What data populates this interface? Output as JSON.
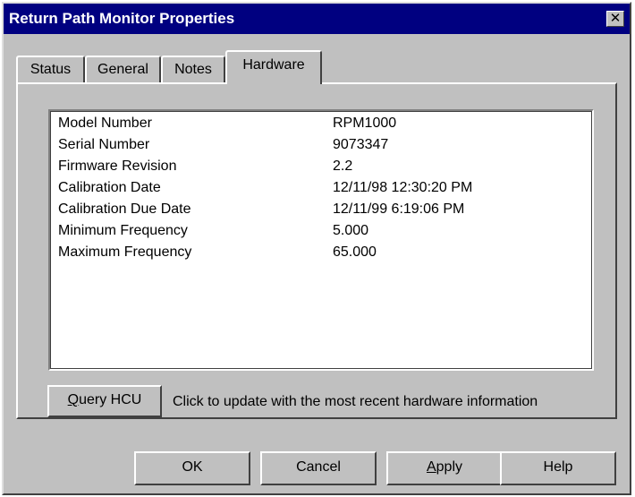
{
  "window": {
    "title": "Return Path Monitor Properties",
    "close_glyph": "✕"
  },
  "tabs": [
    {
      "label": "Status",
      "active": false
    },
    {
      "label": "General",
      "active": false
    },
    {
      "label": "Notes",
      "active": false
    },
    {
      "label": "Hardware",
      "active": true
    }
  ],
  "hardware": {
    "rows": [
      {
        "key": "Model Number",
        "value": "RPM1000"
      },
      {
        "key": "Serial Number",
        "value": "9073347"
      },
      {
        "key": "Firmware Revision",
        "value": "2.2"
      },
      {
        "key": "Calibration Date",
        "value": "12/11/98 12:30:20 PM"
      },
      {
        "key": "Calibration Due Date",
        "value": "12/11/99 6:19:06 PM"
      },
      {
        "key": "Minimum Frequency",
        "value": "5.000"
      },
      {
        "key": "Maximum Frequency",
        "value": "65.000"
      }
    ],
    "query_button_label": "Query HCU",
    "query_hint": "Click to update with the most recent hardware information"
  },
  "buttons": {
    "ok": "OK",
    "cancel": "Cancel",
    "apply": "Apply",
    "help": "Help"
  },
  "colors": {
    "titlebar": "#000080",
    "face": "#c0c0c0"
  }
}
